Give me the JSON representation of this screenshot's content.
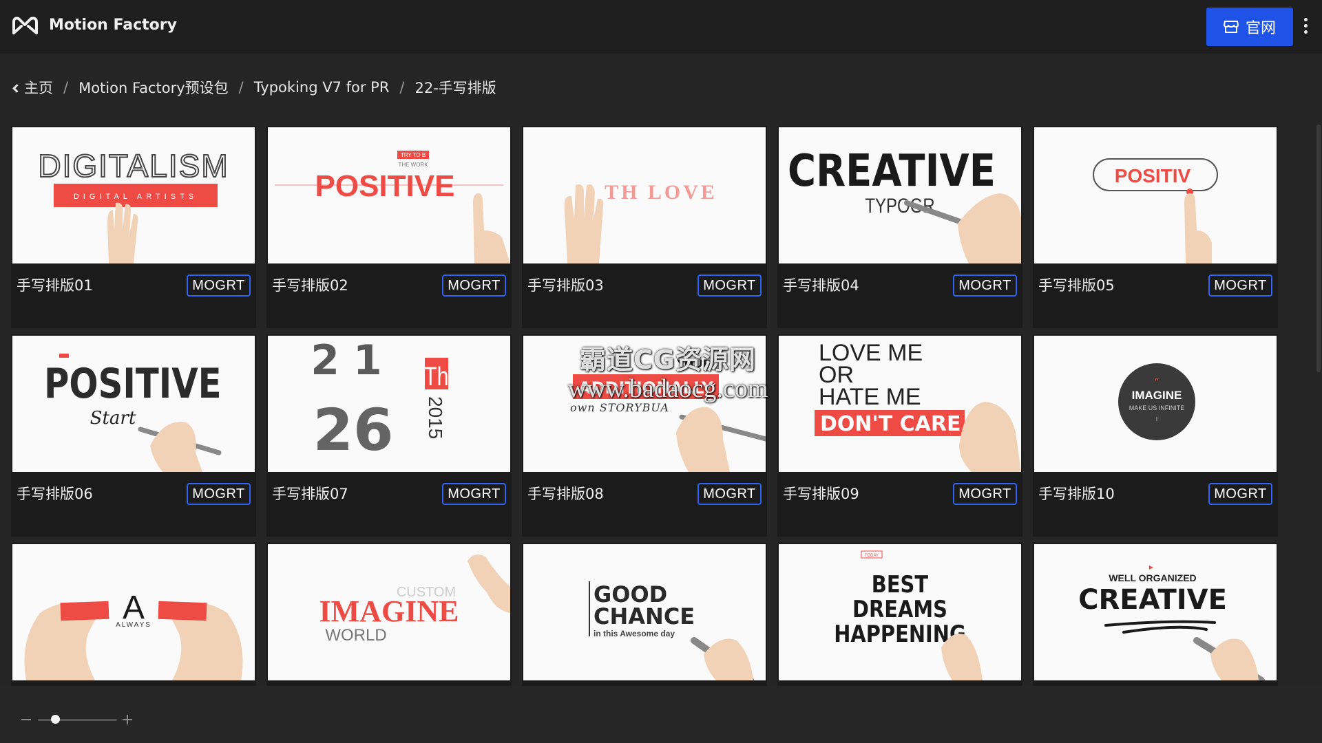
{
  "header": {
    "app_title": "Motion Factory",
    "official_label": "官网",
    "brand_color": "#1f52e6"
  },
  "breadcrumb": {
    "items": [
      "主页",
      "Motion Factory预设包",
      "Typoking V7 for PR",
      "22-手写排版"
    ],
    "separator": "/"
  },
  "cards": [
    {
      "title": "手写排版01",
      "badge": "MOGRT",
      "preview_text": [
        "DIGITALISM",
        "DIGITAL ARTISTS"
      ]
    },
    {
      "title": "手写排版02",
      "badge": "MOGRT",
      "preview_text": [
        "POSITIVE",
        "TRY TO B",
        "THE WORK"
      ]
    },
    {
      "title": "手写排版03",
      "badge": "MOGRT",
      "preview_text": [
        "TH LOVE"
      ]
    },
    {
      "title": "手写排版04",
      "badge": "MOGRT",
      "preview_text": [
        "CREATIVE",
        "TYPOGR"
      ]
    },
    {
      "title": "手写排版05",
      "badge": "MOGRT",
      "preview_text": [
        "POSITIV"
      ]
    },
    {
      "title": "手写排版06",
      "badge": "MOGRT",
      "preview_text": [
        "POSITIVE",
        "Start"
      ]
    },
    {
      "title": "手写排版07",
      "badge": "MOGRT",
      "preview_text": [
        "21",
        "26",
        "Th",
        "2015"
      ]
    },
    {
      "title": "手写排版08",
      "badge": "MOGRT",
      "preview_text": [
        "YOUR",
        "ADDITIONALLY",
        "own STORYBUA"
      ]
    },
    {
      "title": "手写排版09",
      "badge": "MOGRT",
      "preview_text": [
        "LOVE ME",
        "OR",
        "HATE ME",
        "DON'T CARE"
      ]
    },
    {
      "title": "手写排版10",
      "badge": "MOGRT",
      "preview_text": [
        "IMAGINE",
        "MAKE US INFINITE"
      ]
    },
    {
      "preview_text": [
        "A",
        "ALWAYS"
      ]
    },
    {
      "preview_text": [
        "IMAGINE",
        "CUSTOM",
        "WORLD"
      ]
    },
    {
      "preview_text": [
        "GOOD",
        "CHANCE",
        "in this Awesome day"
      ]
    },
    {
      "preview_text": [
        "TODAY",
        "BEST",
        "DREAMS",
        "HAPPENING"
      ]
    },
    {
      "preview_text": [
        "WELL ORGANIZED",
        "CREATIVE"
      ]
    }
  ],
  "watermark": {
    "line1": "霸道CG资源网",
    "line2": "www.badaocg.com"
  },
  "zoom": {
    "level": 0.2
  },
  "colors": {
    "accent_red": "#ee4b45",
    "skin": "#f1d2b6",
    "badge_border": "#2f63f1"
  }
}
